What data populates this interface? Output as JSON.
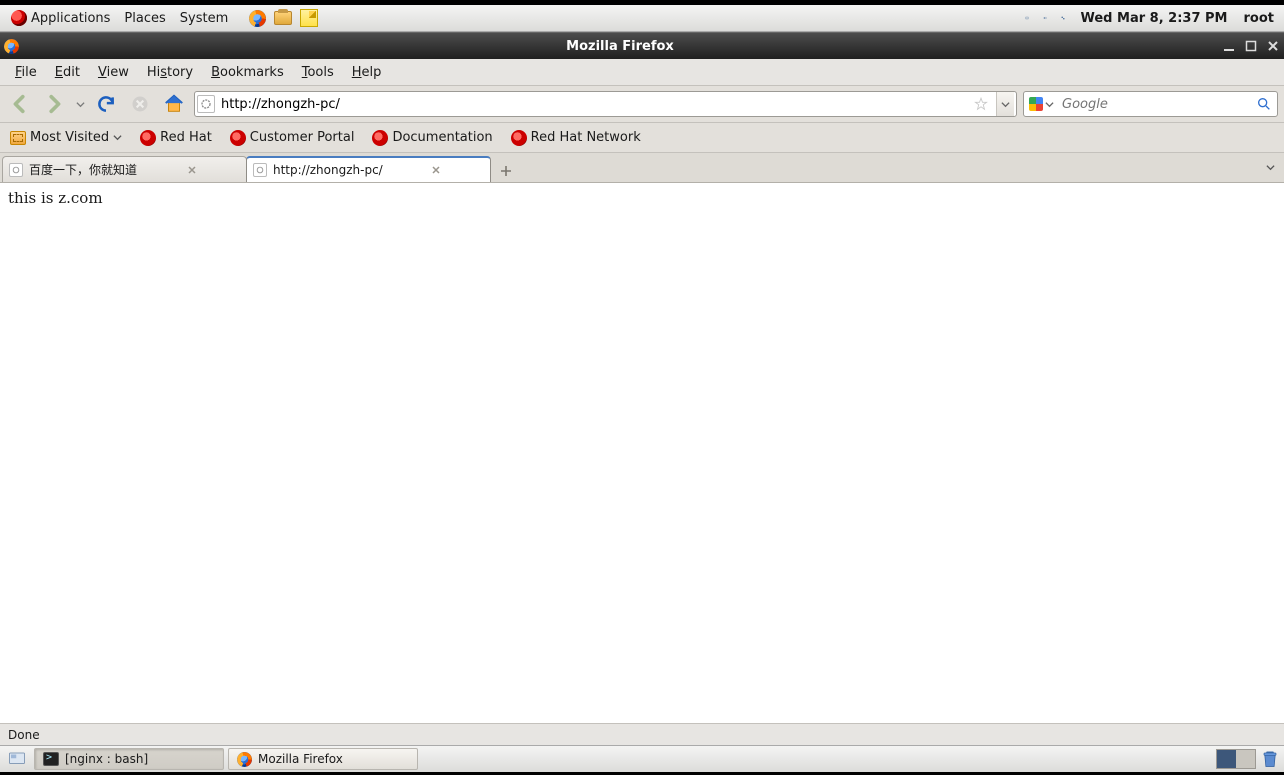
{
  "panel": {
    "apps": "Applications",
    "places": "Places",
    "system": "System",
    "clock": "Wed Mar  8,  2:37 PM",
    "user": "root"
  },
  "window": {
    "title": "Mozilla Firefox"
  },
  "menu": {
    "file": "File",
    "edit": "Edit",
    "view": "View",
    "history": "History",
    "bookmarks": "Bookmarks",
    "tools": "Tools",
    "help": "Help"
  },
  "nav": {
    "url": "http://zhongzh-pc/",
    "search_placeholder": "Google"
  },
  "bookmarks_bar": {
    "most_visited": "Most Visited",
    "items": [
      "Red Hat",
      "Customer Portal",
      "Documentation",
      "Red Hat Network"
    ]
  },
  "tabs": {
    "t0": "百度一下，你就知道",
    "t1": "http://zhongzh-pc/"
  },
  "page": {
    "body_text": "this is z.com"
  },
  "status": {
    "text": "Done"
  },
  "taskbar": {
    "task0": "[nginx : bash]",
    "task1": "Mozilla Firefox"
  }
}
